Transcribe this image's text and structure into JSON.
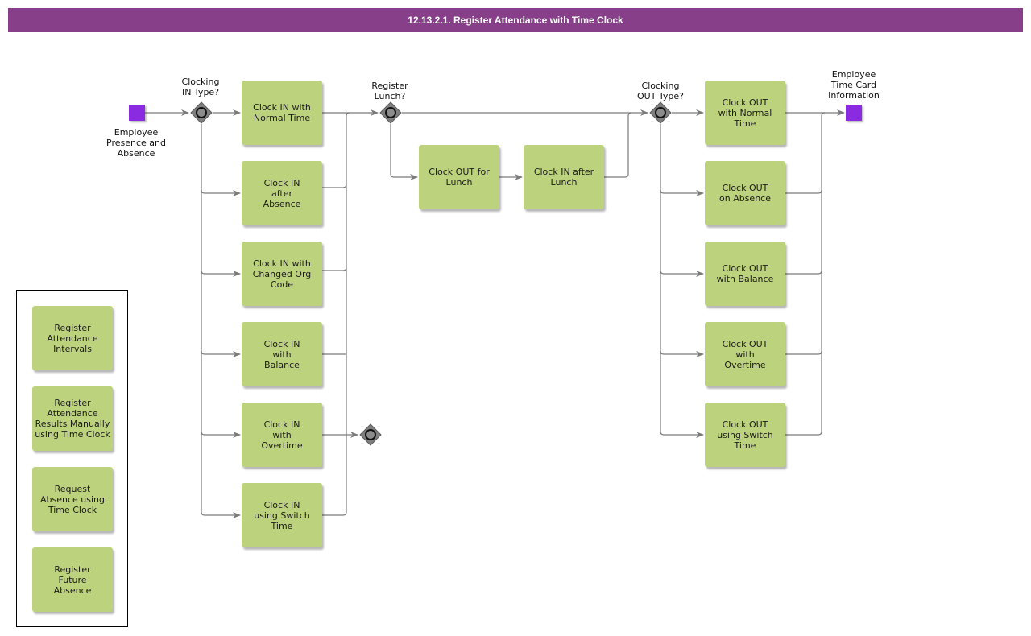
{
  "title": "12.13.2.1. Register Attendance with Time Clock",
  "colors": {
    "title_bar": "#873f8a",
    "task_fill": "#bdd27d",
    "event_fill": "#8a2be2",
    "gateway_fill": "#7f7f7f",
    "flow_line": "#7a7a7a"
  },
  "events": {
    "start": {
      "label": "Employee\nPresence and\nAbsence",
      "icon": "start-event-square"
    },
    "end": {
      "label": "Employee\nTime Card\nInformation",
      "icon": "end-event-square"
    }
  },
  "gateways": {
    "clocking_in": {
      "label": "Clocking\nIN Type?",
      "icon": "inclusive-gateway-diamond"
    },
    "register_lunch": {
      "label": "Register\nLunch?",
      "icon": "inclusive-gateway-diamond"
    },
    "clocking_out": {
      "label": "Clocking\nOUT Type?",
      "icon": "inclusive-gateway-diamond"
    },
    "unlabeled": {
      "label": "",
      "icon": "inclusive-gateway-diamond"
    }
  },
  "clock_in_tasks": [
    {
      "label": "Clock IN with\nNormal Time"
    },
    {
      "label": "Clock IN\nafter\nAbsence"
    },
    {
      "label": "Clock IN with\nChanged Org\nCode"
    },
    {
      "label": "Clock IN\nwith\nBalance"
    },
    {
      "label": "Clock IN\nwith\nOvertime"
    },
    {
      "label": "Clock IN\nusing Switch\nTime"
    }
  ],
  "lunch_tasks": [
    {
      "label": "Clock OUT for\nLunch"
    },
    {
      "label": "Clock IN after\nLunch"
    }
  ],
  "clock_out_tasks": [
    {
      "label": "Clock OUT\nwith Normal\nTime"
    },
    {
      "label": "Clock OUT\non Absence"
    },
    {
      "label": "Clock OUT\nwith Balance"
    },
    {
      "label": "Clock OUT\nwith\nOvertime"
    },
    {
      "label": "Clock OUT\nusing Switch\nTime"
    }
  ],
  "related_processes": [
    {
      "label": "Register\nAttendance\nIntervals"
    },
    {
      "label": "Register\nAttendance\nResults Manually\nusing Time Clock"
    },
    {
      "label": "Request\nAbsence using\nTime Clock"
    },
    {
      "label": "Register\nFuture\nAbsence"
    }
  ]
}
